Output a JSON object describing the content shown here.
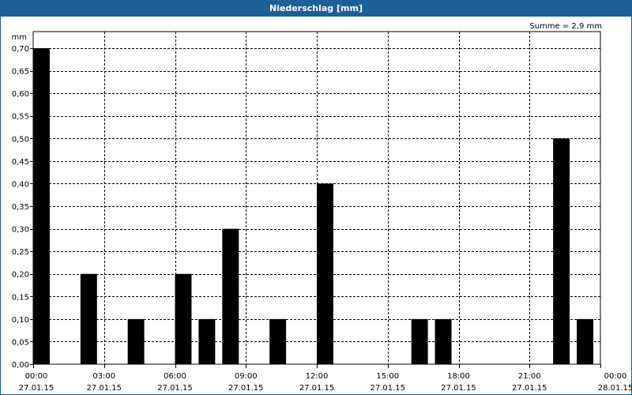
{
  "window": {
    "title": "Niederschlag [mm]"
  },
  "summary": "Summe = 2,9 mm",
  "chart_data": {
    "type": "bar",
    "ylabel": "mm",
    "ylim": [
      0,
      0.7
    ],
    "ystep": 0.05,
    "xlim_hours": [
      0,
      24
    ],
    "grid": true,
    "bar_width_hours": 0.7,
    "color": "#000000",
    "y_ticks": [
      "0,00",
      "0,05",
      "0,10",
      "0,15",
      "0,20",
      "0,25",
      "0,30",
      "0,35",
      "0,40",
      "0,45",
      "0,50",
      "0,55",
      "0,60",
      "0,65",
      "0,70"
    ],
    "x_ticks": [
      {
        "time": "00:00",
        "date": "27.01.15"
      },
      {
        "time": "03:00",
        "date": "27.01.15"
      },
      {
        "time": "06:00",
        "date": "27.01.15"
      },
      {
        "time": "09:00",
        "date": "27.01.15"
      },
      {
        "time": "12:00",
        "date": "27.01.15"
      },
      {
        "time": "15:00",
        "date": "27.01.15"
      },
      {
        "time": "18:00",
        "date": "27.01.15"
      },
      {
        "time": "21:00",
        "date": "27.01.15"
      },
      {
        "time": "00:00",
        "date": "28.01.15"
      }
    ],
    "bars": [
      {
        "hour": 0,
        "value": 0.7
      },
      {
        "hour": 2,
        "value": 0.2
      },
      {
        "hour": 4,
        "value": 0.1
      },
      {
        "hour": 6,
        "value": 0.2
      },
      {
        "hour": 7,
        "value": 0.1
      },
      {
        "hour": 8,
        "value": 0.3
      },
      {
        "hour": 10,
        "value": 0.1
      },
      {
        "hour": 12,
        "value": 0.4
      },
      {
        "hour": 16,
        "value": 0.1
      },
      {
        "hour": 17,
        "value": 0.1
      },
      {
        "hour": 22,
        "value": 0.5
      },
      {
        "hour": 23,
        "value": 0.1
      }
    ]
  }
}
